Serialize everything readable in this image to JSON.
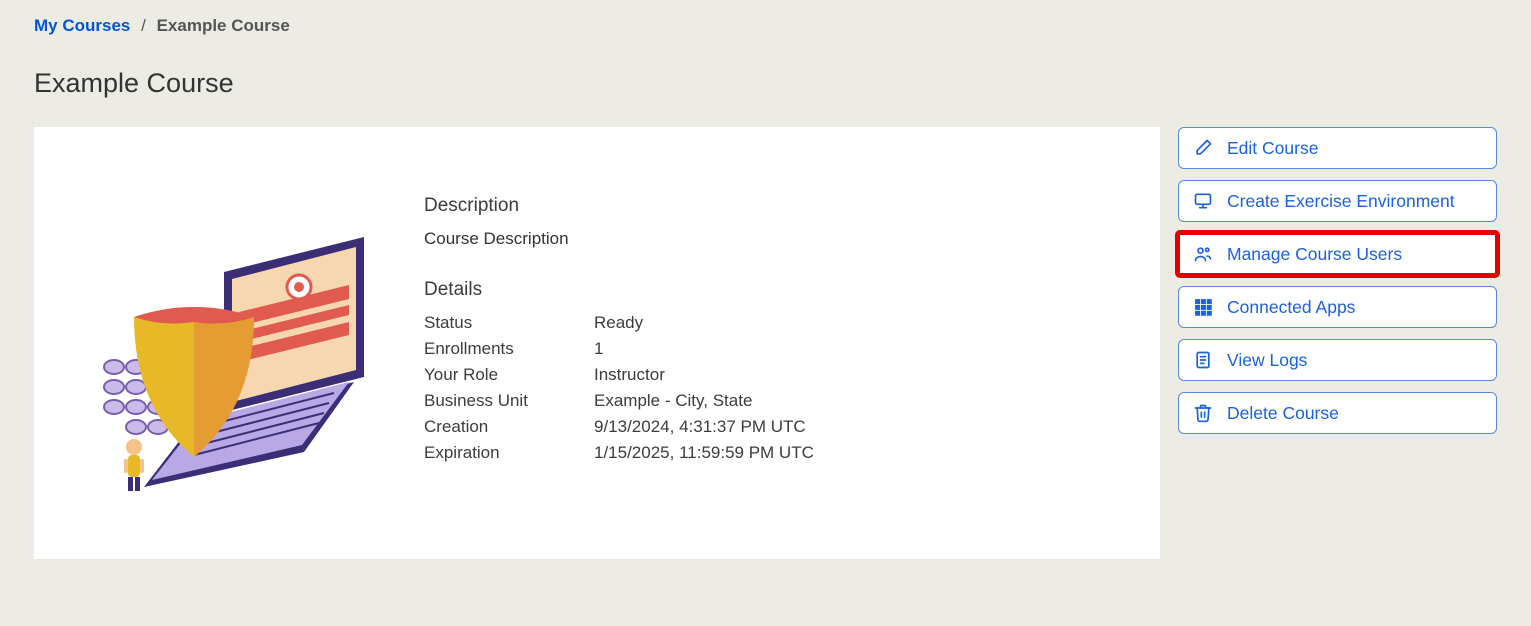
{
  "breadcrumb": {
    "root": "My Courses",
    "current": "Example Course"
  },
  "page_title": "Example Course",
  "description": {
    "heading": "Description",
    "text": "Course Description"
  },
  "details": {
    "heading": "Details",
    "rows": [
      {
        "label": "Status",
        "value": "Ready"
      },
      {
        "label": "Enrollments",
        "value": "1"
      },
      {
        "label": "Your Role",
        "value": "Instructor"
      },
      {
        "label": "Business Unit",
        "value": "Example - City, State"
      },
      {
        "label": "Creation",
        "value": "9/13/2024, 4:31:37 PM UTC"
      },
      {
        "label": "Expiration",
        "value": "1/15/2025, 11:59:59 PM UTC"
      }
    ]
  },
  "actions": {
    "edit": "Edit Course",
    "create_env": "Create Exercise Environment",
    "manage_users": "Manage Course Users",
    "connected_apps": "Connected Apps",
    "view_logs": "View Logs",
    "delete": "Delete Course"
  }
}
